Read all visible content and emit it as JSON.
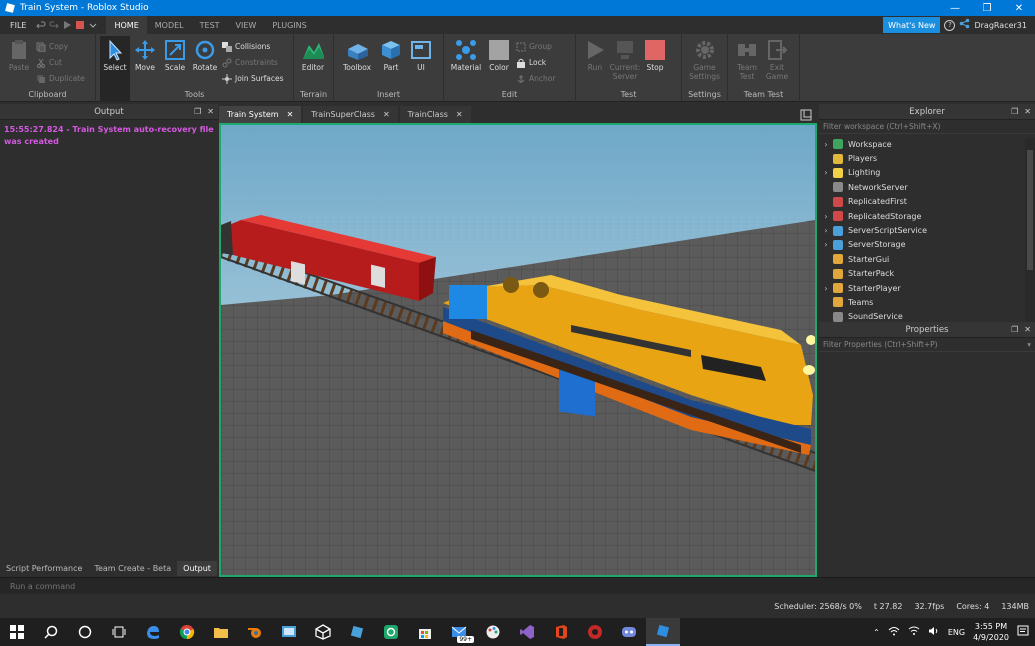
{
  "window": {
    "title": "Train System - Roblox Studio"
  },
  "menu": {
    "file": "FILE",
    "tabs": [
      "HOME",
      "MODEL",
      "TEST",
      "VIEW",
      "PLUGINS"
    ],
    "whats_new": "What's New",
    "username": "DragRacer31"
  },
  "ribbon": {
    "clipboard": {
      "paste": "Paste",
      "copy": "Copy",
      "cut": "Cut",
      "duplicate": "Duplicate",
      "label": "Clipboard"
    },
    "tools": {
      "select": "Select",
      "move": "Move",
      "scale": "Scale",
      "rotate": "Rotate",
      "collisions": "Collisions",
      "constraints": "Constraints",
      "join_surfaces": "Join Surfaces",
      "label": "Tools"
    },
    "terrain": {
      "editor": "Editor",
      "label": "Terrain"
    },
    "insert": {
      "toolbox": "Toolbox",
      "part": "Part",
      "ui": "UI",
      "label": "Insert"
    },
    "edit": {
      "material": "Material",
      "color": "Color",
      "group": "Group",
      "lock": "Lock",
      "anchor": "Anchor",
      "label": "Edit"
    },
    "test": {
      "run": "Run",
      "current_server": "Current: Server",
      "stop": "Stop",
      "label": "Test"
    },
    "settings": {
      "game_settings": "Game Settings",
      "label": "Settings"
    },
    "team_test": {
      "team_test": "Team Test",
      "exit_game": "Exit Game",
      "label": "Team Test"
    }
  },
  "output": {
    "title": "Output",
    "log": "15:55:27.824 - Train System auto-recovery file was created",
    "tabs": [
      "Script Performance",
      "Team Create - Beta",
      "Output"
    ]
  },
  "doc_tabs": [
    "Train System",
    "TrainSuperClass",
    "TrainClass"
  ],
  "explorer": {
    "title": "Explorer",
    "filter_placeholder": "Filter workspace (Ctrl+Shift+X)",
    "items": [
      {
        "label": "Workspace",
        "expand": true,
        "color": "#3da55c"
      },
      {
        "label": "Players",
        "expand": false,
        "color": "#e0b83a"
      },
      {
        "label": "Lighting",
        "expand": true,
        "color": "#f2d046"
      },
      {
        "label": "NetworkServer",
        "expand": false,
        "color": "#8a8a8a"
      },
      {
        "label": "ReplicatedFirst",
        "expand": false,
        "color": "#d04848"
      },
      {
        "label": "ReplicatedStorage",
        "expand": true,
        "color": "#d04848"
      },
      {
        "label": "ServerScriptService",
        "expand": true,
        "color": "#4aa0d8"
      },
      {
        "label": "ServerStorage",
        "expand": true,
        "color": "#4aa0d8"
      },
      {
        "label": "StarterGui",
        "expand": false,
        "color": "#e0a83a"
      },
      {
        "label": "StarterPack",
        "expand": false,
        "color": "#e0a83a"
      },
      {
        "label": "StarterPlayer",
        "expand": true,
        "color": "#e0a83a"
      },
      {
        "label": "Teams",
        "expand": false,
        "color": "#e0a83a"
      },
      {
        "label": "SoundService",
        "expand": false,
        "color": "#888888"
      }
    ]
  },
  "properties": {
    "title": "Properties",
    "filter_placeholder": "Filter Properties (Ctrl+Shift+P)"
  },
  "command_bar": {
    "placeholder": "Run a command"
  },
  "status": {
    "scheduler": "Scheduler: 2568/s 0%",
    "t": "t 27.82",
    "fps": "32.7fps",
    "cores": "Cores: 4",
    "mem": "134MB"
  },
  "taskbar": {
    "lang": "ENG",
    "time": "3:55 PM",
    "date": "4/9/2020",
    "badge": "99+"
  },
  "colors": {
    "accent": "#0078d7",
    "viewport_border": "#1fa86b",
    "log_text": "#d459e0"
  }
}
